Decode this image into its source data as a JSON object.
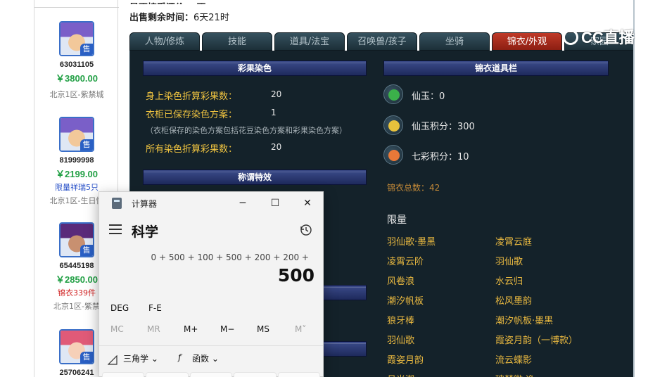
{
  "sellers": [
    {
      "id": "63031105",
      "price": "￥3800.00",
      "tag": "",
      "tag_color": "",
      "server": "北京1区-紫禁城",
      "sold_badge": "售",
      "face": [
        "#7a5fc8",
        "#f2c89a"
      ]
    },
    {
      "id": "81999998",
      "price": "￥2199.00",
      "tag": "限量祥瑞5只",
      "tag_color": "#2a52c8",
      "server": "北京1区-生日快",
      "sold_badge": "售",
      "face": [
        "#7a5fc8",
        "#f2c89a"
      ]
    },
    {
      "id": "65445198",
      "price": "￥2850.00",
      "tag": "锦衣339件",
      "tag_color": "#d02020",
      "server": "北京1区-紫禁",
      "sold_badge": "售",
      "face": [
        "#5a2a7a",
        "#c89070"
      ]
    },
    {
      "id": "25706241",
      "price": "",
      "tag": "",
      "tag_color": "",
      "server": "",
      "sold_badge": "售",
      "face": [
        "#e05a78",
        "#f6d0b8"
      ]
    }
  ],
  "detail": {
    "top_cut": "是否接受还价：   否",
    "remaining_label": "出售剩余时间：",
    "remaining_value": "6天21时",
    "tabs": [
      "人物/修炼",
      "技能",
      "道具/法宝",
      "召唤兽/孩子",
      "坐骑",
      "锦衣/外观",
      "家园"
    ],
    "active_tab": 5,
    "dye_banner": "彩果染色",
    "dye_stats": [
      {
        "label": "身上染色折算彩果数：",
        "value": "20"
      },
      {
        "label": "衣柜已保存染色方案：",
        "value": "1"
      }
    ],
    "dye_note": "（衣柜保存的染色方案包括花豆染色方案和彩果染色方案）",
    "dye_total": {
      "label": "所有染色折算彩果数：",
      "value": "20"
    },
    "title_banner": "称谓特效",
    "props_banner": "锦衣道具栏",
    "props": [
      {
        "label": "仙玉：0",
        "color": "#3bb04a"
      },
      {
        "label": "仙玉积分：300",
        "color": "#e8c23c"
      },
      {
        "label": "七彩积分：10",
        "color": "#e87838"
      }
    ],
    "total": "锦衣总数：42",
    "limit_label": "限量",
    "items_col1": [
      "羽仙歌·墨黑",
      "凌霄云阶",
      "风卷浪",
      "潮汐帆板",
      "狼牙棒",
      "羽仙歌",
      "霞姿月韵",
      "月光潮"
    ],
    "items_col2": [
      "凌霄云庭",
      "羽仙歌",
      "水云归",
      "松风墨韵",
      "潮汐帆板·墨黑",
      "霞姿月韵（一博款）",
      "流云蝶影",
      "瑰梦徽·逸"
    ]
  },
  "watermark": "CC直播",
  "calculator": {
    "app_title": "计算器",
    "mode": "科学",
    "expression": "0 + 500 + 100 + 500 + 200 + 200 +",
    "result": "500",
    "angle_unit": "DEG",
    "notation": "F-E",
    "memory": [
      {
        "label": "MC",
        "enabled": false
      },
      {
        "label": "MR",
        "enabled": false
      },
      {
        "label": "M+",
        "enabled": true
      },
      {
        "label": "M−",
        "enabled": true
      },
      {
        "label": "MS",
        "enabled": true
      },
      {
        "label": "M˅",
        "enabled": false
      }
    ],
    "trig_label": "三角学",
    "func_label": "函数",
    "min_glyph": "─",
    "max_glyph": "☐",
    "close_glyph": "✕"
  }
}
